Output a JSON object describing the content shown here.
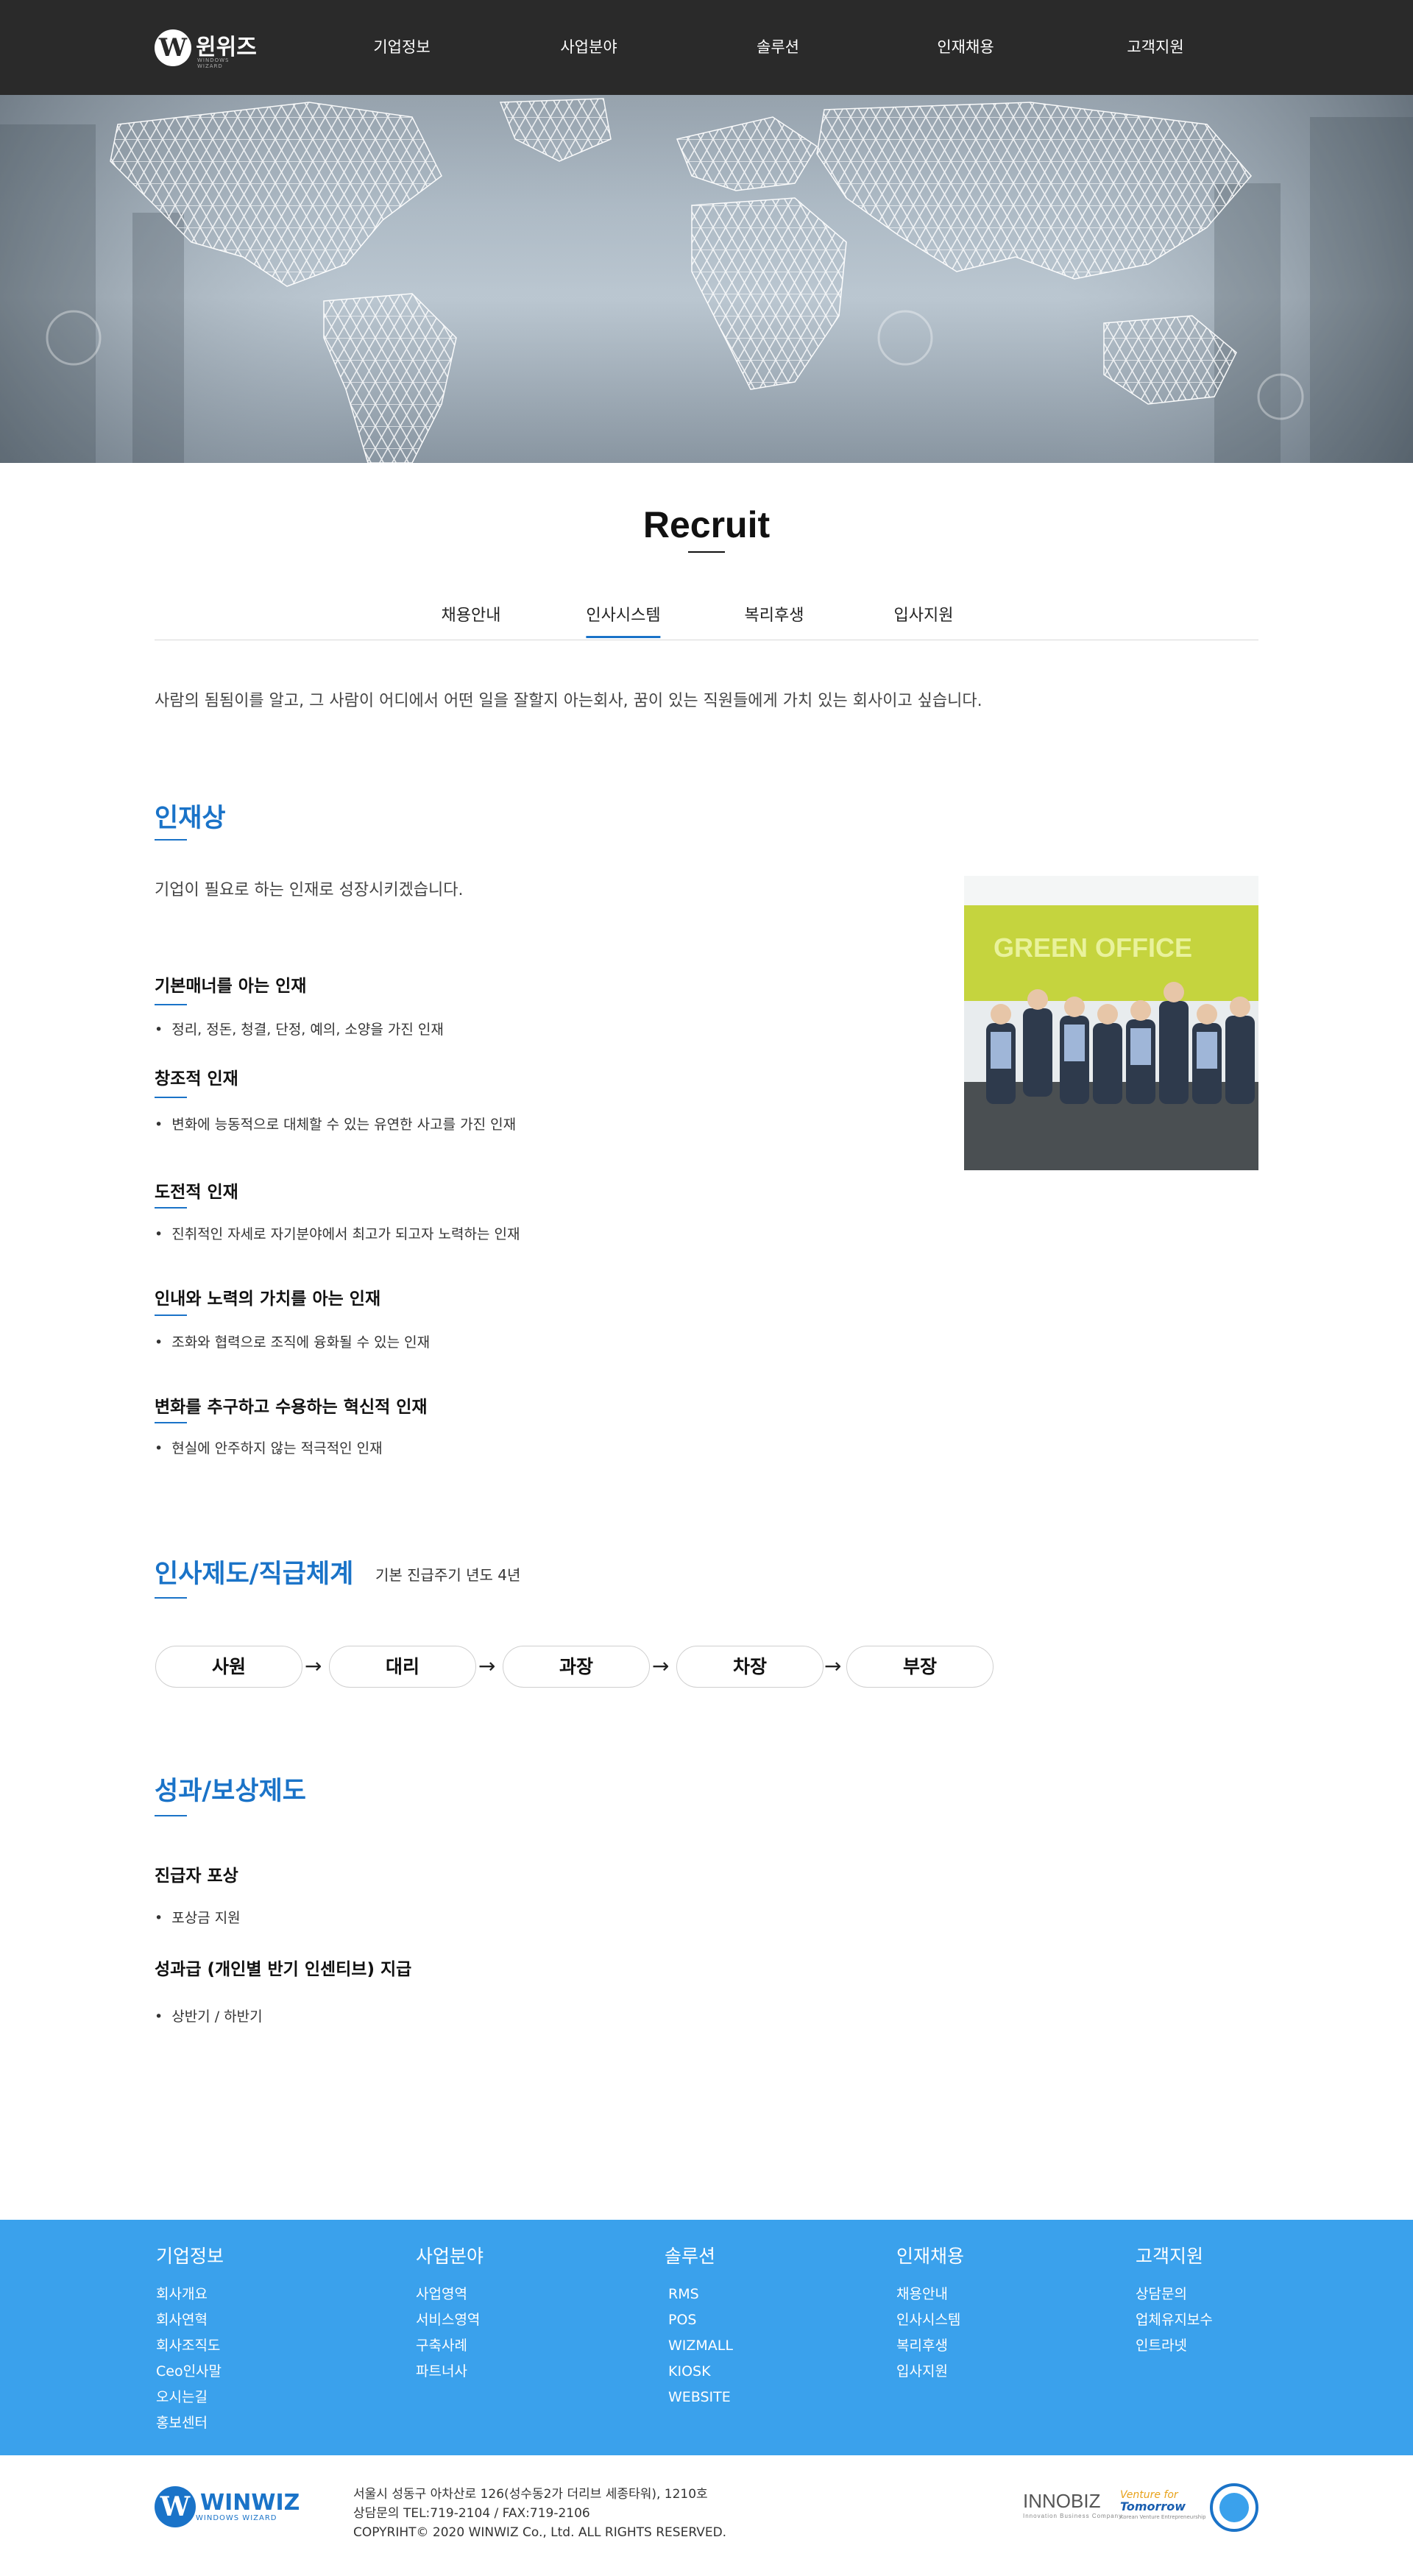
{
  "header": {
    "logo_mark": "W",
    "logo_text": "윈위즈",
    "logo_sub": "WINDOWS WIZARD",
    "nav": [
      "기업정보",
      "사업분야",
      "솔루션",
      "인재채용",
      "고객지원"
    ]
  },
  "page": {
    "title": "Recruit",
    "tabs": [
      "채용안내",
      "인사시스템",
      "복리후생",
      "입사지원"
    ],
    "active_tab": "인사시스템",
    "intro": "사람의 됨됨이를 알고, 그 사람이 어디에서 어떤 일을 잘할지 아는회사, 꿈이 있는 직원들에게 가치 있는 회사이고 싶습니다."
  },
  "talent": {
    "title": "인재상",
    "lead": "기업이 필요로 하는 인재로 성장시키겠습니다.",
    "items": [
      {
        "title": "기본매너를 아는 인재",
        "desc": "정리, 정돈, 청결, 단정, 예의, 소양을 가진 인재"
      },
      {
        "title": "창조적 인재",
        "desc": "변화에 능동적으로 대체할 수 있는 유연한 사고를 가진 인재"
      },
      {
        "title": "도전적 인재",
        "desc": "진취적인 자세로 자기분야에서 최고가 되고자 노력하는 인재"
      },
      {
        "title": "인내와 노력의 가치를 아는 인재",
        "desc": "조화와 협력으로 조직에 융화될 수 있는 인재"
      },
      {
        "title": "변화를 추구하고 수용하는 혁신적 인재",
        "desc": "현실에 안주하지 않는 적극적인 인재"
      }
    ],
    "photo_sign": "GREEN OFFICE"
  },
  "hr_system": {
    "title": "인사제도/직급체계",
    "note": "기본 진급주기 년도 4년",
    "ranks": [
      "사원",
      "대리",
      "과장",
      "차장",
      "부장"
    ],
    "arrow": "→"
  },
  "reward": {
    "title": "성과/보상제도",
    "items": [
      {
        "title": "진급자 포상",
        "desc": "포상금 지원"
      },
      {
        "title": "성과급 (개인별 반기 인센티브) 지급",
        "desc": "상반기 / 하반기"
      }
    ]
  },
  "footer": {
    "columns": [
      {
        "head": "기업정보",
        "links": [
          "회사개요",
          "회사연혁",
          "회사조직도",
          "Ceo인사말",
          "오시는길",
          "홍보센터"
        ]
      },
      {
        "head": "사업분야",
        "links": [
          "사업영역",
          "서비스영역",
          "구축사례",
          "파트너사"
        ]
      },
      {
        "head": "솔루션",
        "links": [
          "RMS",
          "POS",
          "WIZMALL",
          "KIOSK",
          "WEBSITE"
        ]
      },
      {
        "head": "인재채용",
        "links": [
          "채용안내",
          "인사시스템",
          "복리후생",
          "입사지원"
        ]
      },
      {
        "head": "고객지원",
        "links": [
          "상담문의",
          "업체유지보수",
          "인트라넷"
        ]
      }
    ],
    "logo_mark": "W",
    "logo_text": "WINWIZ",
    "logo_sub": "WINDOWS WIZARD",
    "address": "서울시 성동구 아차산로 126(성수동2가 더리브 세종타워), 1210호",
    "contact": "상담문의 TEL:719-2104 / FAX:719-2106",
    "copyright": "COPYRIHT© 2020 WINWIZ Co., Ltd. ALL RIGHTS RESERVED.",
    "cert_innobiz": "INNOBIZ",
    "cert_innobiz_sub": "Innovation Business Company",
    "cert_venture_top": "Venture for",
    "cert_venture_main": "Tomorrow",
    "cert_venture_sub": "Korean Venture Entrepreneurship"
  },
  "colors": {
    "header_bg": "#2a2a2a",
    "accent": "#1a73c8",
    "footer_bg": "#3aa1ec"
  }
}
